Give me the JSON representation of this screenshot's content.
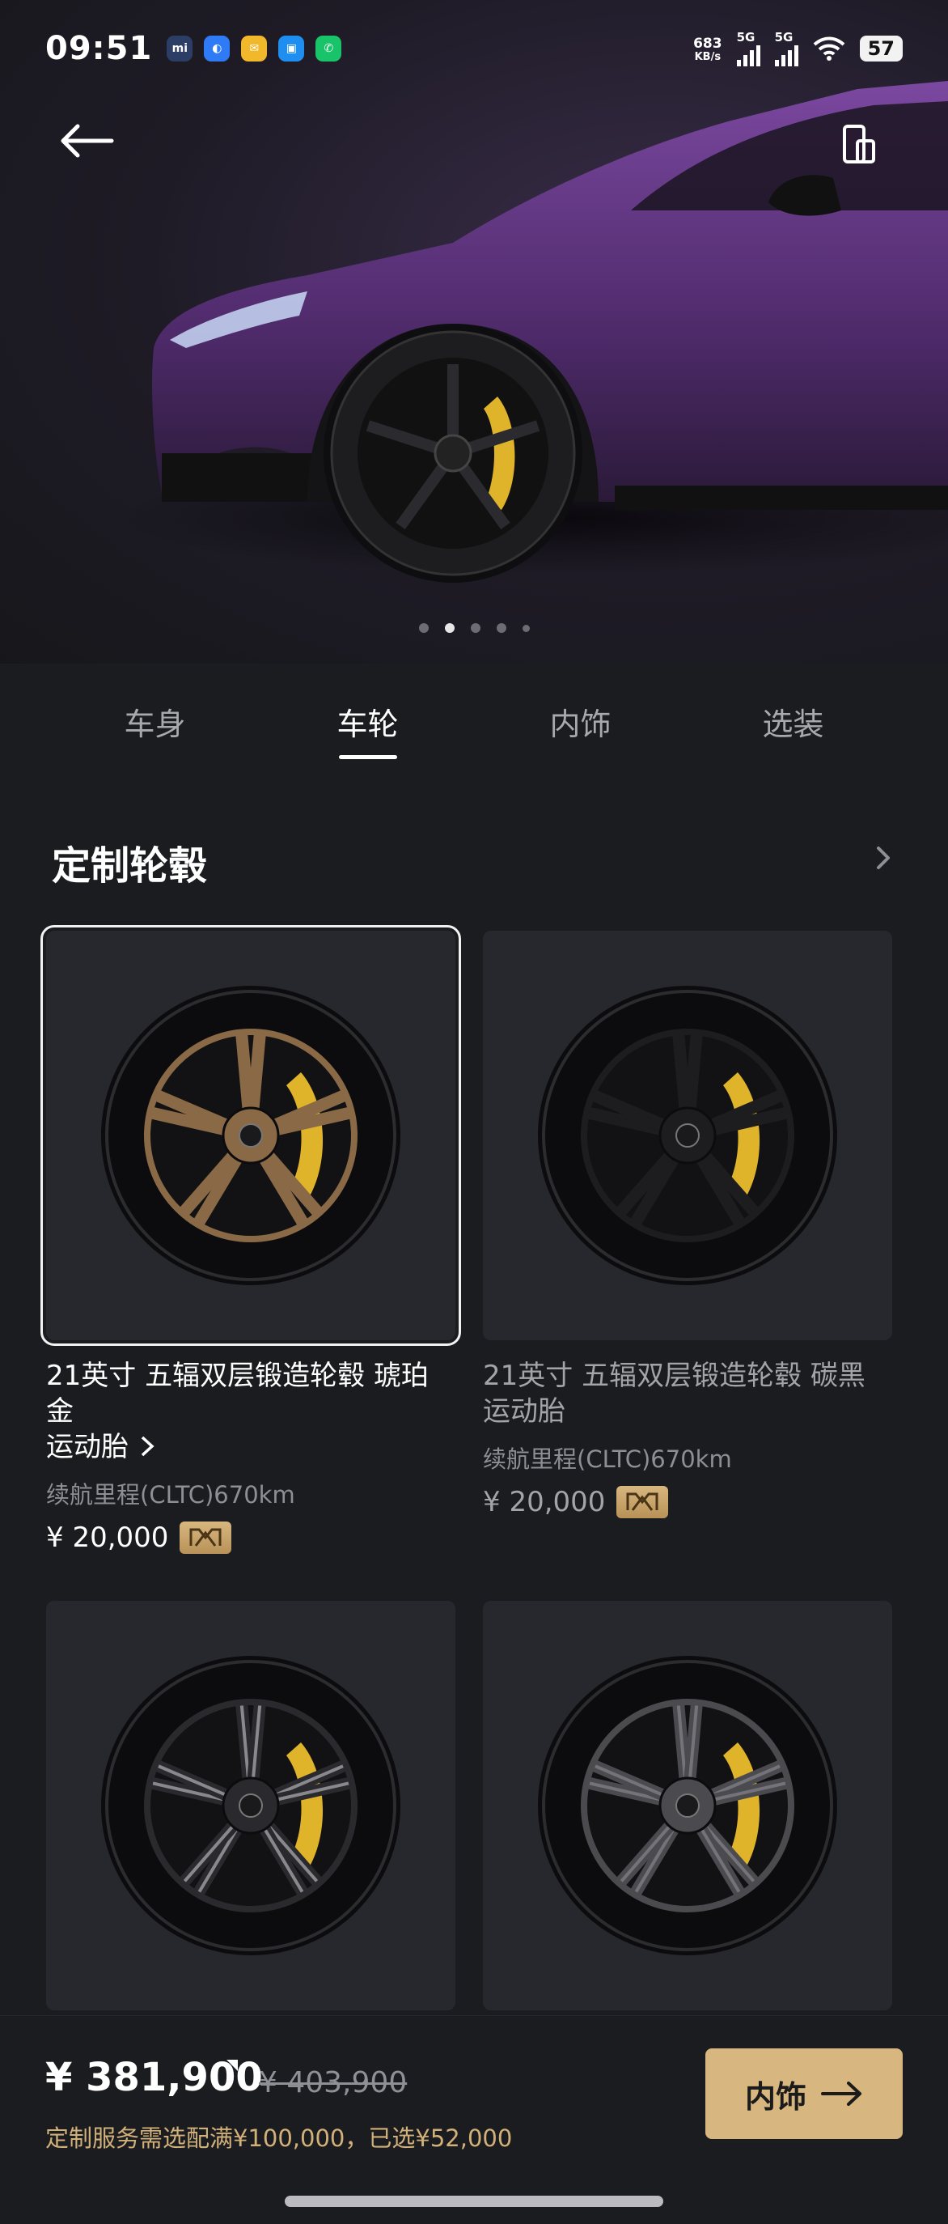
{
  "status_bar": {
    "time": "09:51",
    "net_speed_value": "683",
    "net_speed_unit": "KB/s",
    "signal1_label": "5G",
    "signal2_label": "5G",
    "battery": "57",
    "app_icons": [
      "mi-app-icon",
      "blue-app-icon",
      "mail-app-icon",
      "blue-square-app-icon",
      "green-phone-app-icon"
    ]
  },
  "hero": {
    "car_color": "#5b2f7a",
    "carousel_count": 5,
    "carousel_active": 1
  },
  "tabs": [
    {
      "label": "车身",
      "active": false
    },
    {
      "label": "车轮",
      "active": true
    },
    {
      "label": "内饰",
      "active": false
    },
    {
      "label": "选装",
      "active": false
    }
  ],
  "section": {
    "title": "定制轮毂"
  },
  "wheels": [
    {
      "title_line1": "21英寸 五辐双层锻造轮毂 琥珀",
      "title_line2": "金",
      "title_line3": "运动胎",
      "range": "续航里程(CLTC)670km",
      "price": "¥ 20,000",
      "selected": true,
      "rim_color": "#8a6a46"
    },
    {
      "title_line1": "21英寸 五辐双层锻造轮毂 碳黑",
      "title_line2": "运动胎",
      "title_line3": "",
      "range": "续航里程(CLTC)670km",
      "price": "¥ 20,000",
      "selected": false,
      "rim_color": "#1d1d20"
    },
    {
      "rim_color": "#2a2a2e",
      "accent": "#c9c9cc"
    },
    {
      "rim_color": "#4a4a4f",
      "accent": "#8f8f95"
    }
  ],
  "bottom_bar": {
    "total_price": "¥ 381,900",
    "original_price": "¥ 403,900",
    "note": "定制服务需选配满¥100,000，已选¥52,000",
    "next_label": "内饰"
  },
  "colors": {
    "accent_gold": "#d7b67f",
    "background": "#1b1c1f"
  }
}
